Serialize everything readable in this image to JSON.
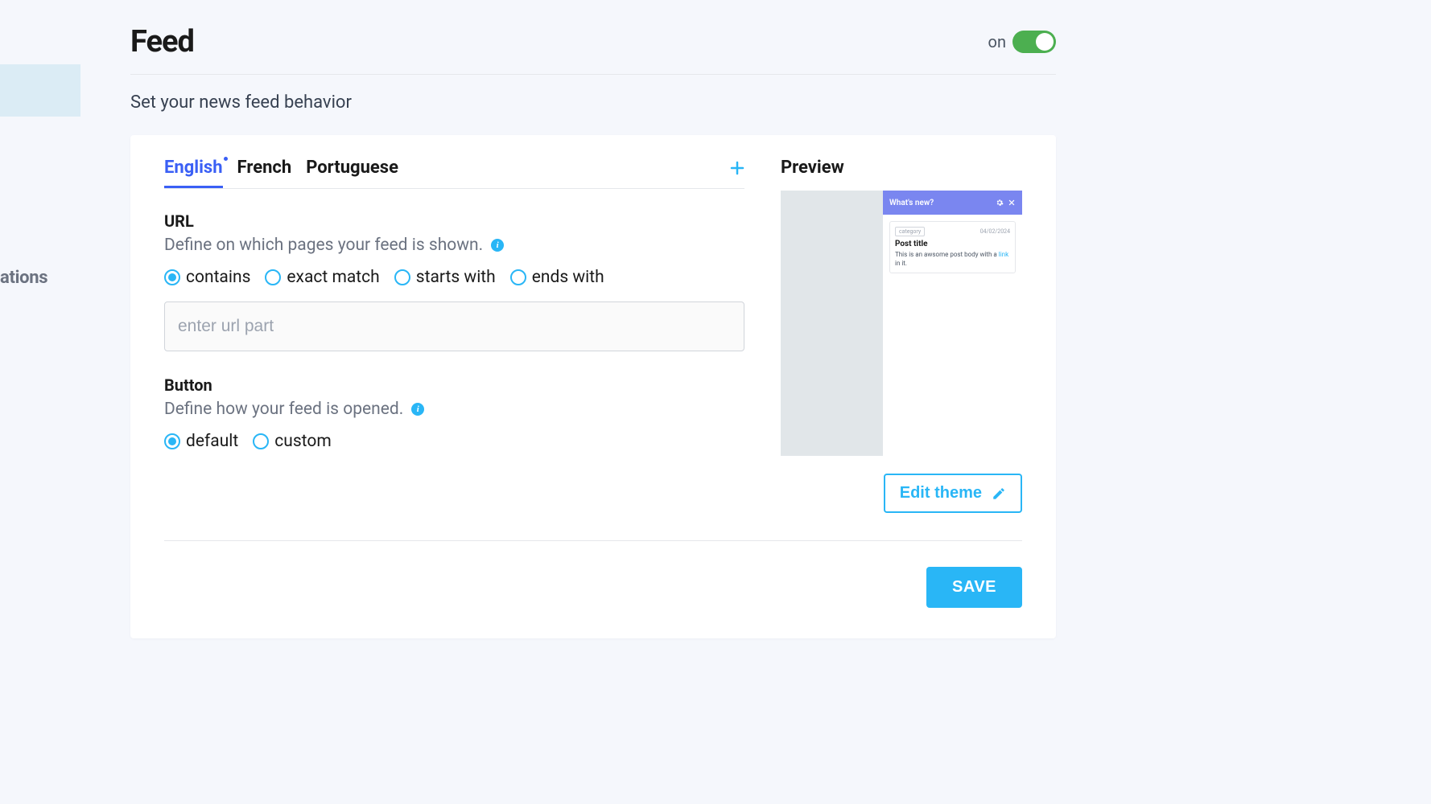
{
  "sidebar": {
    "partial_label": "ations"
  },
  "header": {
    "title": "Feed",
    "toggle_label": "on",
    "toggle_on": true
  },
  "subtitle": "Set your news feed behavior",
  "tabs": [
    {
      "label": "English",
      "active": true
    },
    {
      "label": "French",
      "active": false
    },
    {
      "label": "Portuguese",
      "active": false
    }
  ],
  "url_section": {
    "title": "URL",
    "desc": "Define on which pages your feed is shown.",
    "radios": [
      {
        "label": "contains",
        "checked": true
      },
      {
        "label": "exact match",
        "checked": false
      },
      {
        "label": "starts with",
        "checked": false
      },
      {
        "label": "ends with",
        "checked": false
      }
    ],
    "input_placeholder": "enter url part"
  },
  "button_section": {
    "title": "Button",
    "desc": "Define how your feed is opened.",
    "radios": [
      {
        "label": "default",
        "checked": true
      },
      {
        "label": "custom",
        "checked": false
      }
    ]
  },
  "preview": {
    "title": "Preview",
    "header_text": "What's new?",
    "post": {
      "category": "category",
      "date": "04/02/2024",
      "title": "Post title",
      "body_pre": "This is an awsome post body with a ",
      "link": "link",
      "body_post": " in it."
    },
    "edit_theme": "Edit theme"
  },
  "save_label": "SAVE"
}
